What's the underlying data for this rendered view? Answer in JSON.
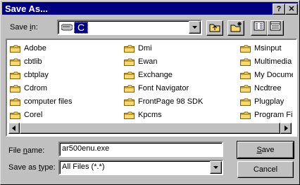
{
  "window": {
    "title": "Save As...",
    "help_label": "?",
    "close_label": "✕"
  },
  "savein": {
    "label_prefix": "Save ",
    "label_underlined": "i",
    "label_suffix": "n:",
    "value": "C"
  },
  "toolbar": {
    "icons": [
      "up-one-level-icon",
      "create-new-folder-icon",
      "list-view-icon",
      "details-view-icon"
    ]
  },
  "files": {
    "col1": [
      "Adobe",
      "cbtlib",
      "cbtplay",
      "Cdrom",
      "computer files",
      "Corel"
    ],
    "col2": [
      "Dmi",
      "Ewan",
      "Exchange",
      "Font Navigator",
      "FrontPage 98 SDK",
      "Kpcms"
    ],
    "col3": [
      "Msinput",
      "Multimedia F",
      "My Docume",
      "Ncdtree",
      "Plugplay",
      "Program File"
    ]
  },
  "filename": {
    "label_prefix": "File ",
    "label_underlined": "n",
    "label_suffix": "ame:",
    "value": "ar500enu.exe"
  },
  "filetype": {
    "label_prefix": "Save as ",
    "label_underlined": "t",
    "label_suffix": "ype:",
    "value": "All Files (*.*)"
  },
  "buttons": {
    "save_underlined": "S",
    "save_rest": "ave",
    "cancel": "Cancel"
  },
  "colors": {
    "titlebar": "#000080",
    "folder": "#f8d870",
    "selection": "#000080"
  }
}
